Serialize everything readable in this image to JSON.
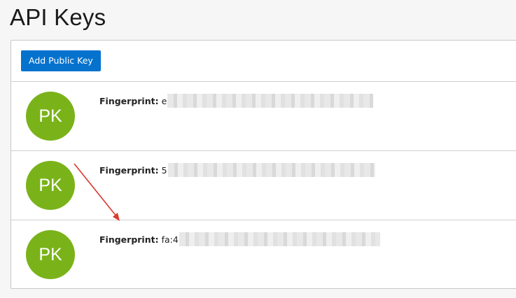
{
  "page": {
    "title": "API Keys"
  },
  "toolbar": {
    "add_button_label": "Add Public Key"
  },
  "keys": [
    {
      "avatar_initials": "PK",
      "fingerprint_label": "Fingerprint:",
      "fingerprint_visible": "e"
    },
    {
      "avatar_initials": "PK",
      "fingerprint_label": "Fingerprint:",
      "fingerprint_visible": "5"
    },
    {
      "avatar_initials": "PK",
      "fingerprint_label": "Fingerprint:",
      "fingerprint_visible": "fa:4"
    }
  ],
  "colors": {
    "avatar": "#7ab319",
    "primary_button": "#0572ce",
    "annotation_arrow": "#d93a2b"
  },
  "annotation": {
    "type": "arrow",
    "icon": "arrow-annotation-icon"
  }
}
